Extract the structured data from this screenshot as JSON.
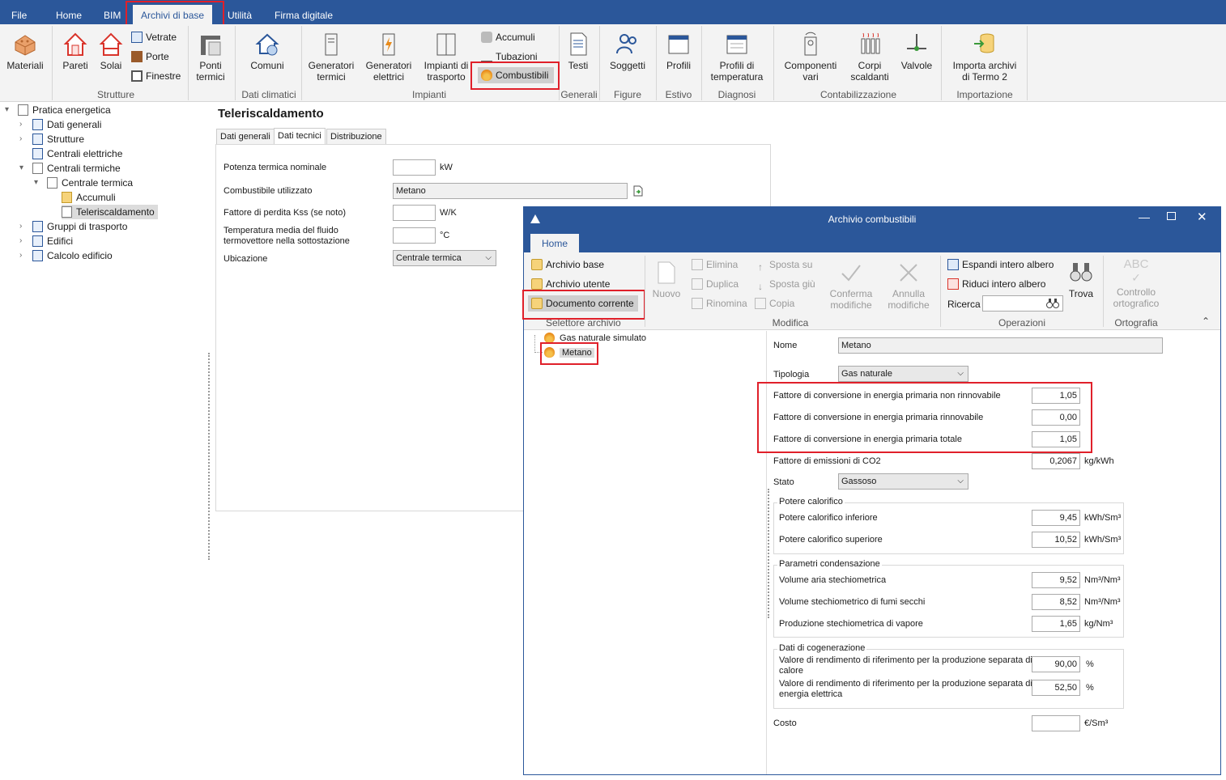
{
  "menubar": {
    "items": [
      "File",
      "Home",
      "BIM",
      "Archivi di base",
      "Utilità",
      "Firma digitale"
    ],
    "active": "Archivi di base"
  },
  "ribbon": {
    "materiali": "Materiali",
    "pareti": "Pareti",
    "solai": "Solai",
    "vetrate": "Vetrate",
    "porte": "Porte",
    "finestre": "Finestre",
    "ponti_termici_1": "Ponti",
    "ponti_termici_2": "termici",
    "comuni": "Comuni",
    "gen_termici_1": "Generatori",
    "gen_termici_2": "termici",
    "gen_elettrici_1": "Generatori",
    "gen_elettrici_2": "elettrici",
    "impianti_trasp_1": "Impianti di",
    "impianti_trasp_2": "trasporto",
    "accumuli": "Accumuli",
    "tubazioni": "Tubazioni",
    "combustibili": "Combustibili",
    "testi": "Testi",
    "soggetti": "Soggetti",
    "profili": "Profili",
    "profili_temp_1": "Profili di",
    "profili_temp_2": "temperatura",
    "componenti_1": "Componenti",
    "componenti_2": "vari",
    "corpi_1": "Corpi",
    "corpi_2": "scaldanti",
    "valvole": "Valvole",
    "importa_1": "Importa archivi",
    "importa_2": "di Termo 2",
    "groups": {
      "strutture": "Strutture",
      "dati_climatici": "Dati climatici",
      "impianti": "Impianti",
      "generali": "Generali",
      "figure": "Figure",
      "estivo": "Estivo",
      "diagnosi": "Diagnosi",
      "contabilizzazione": "Contabilizzazione",
      "importazione": "Importazione"
    }
  },
  "tree": {
    "root": "Pratica energetica",
    "dati_generali": "Dati generali",
    "strutture": "Strutture",
    "centrali_elettriche": "Centrali elettriche",
    "centrali_termiche": "Centrali termiche",
    "centrale_termica": "Centrale termica",
    "accumuli": "Accumuli",
    "teleriscaldamento": "Teleriscaldamento",
    "gruppi_trasporto": "Gruppi di trasporto",
    "edifici": "Edifici",
    "calcolo_edificio": "Calcolo edificio"
  },
  "panel": {
    "title": "Teleriscaldamento",
    "tabs": [
      "Dati generali",
      "Dati tecnici",
      "Distribuzione"
    ],
    "potenza_label": "Potenza termica nominale",
    "potenza_unit": "kW",
    "combustibile_label": "Combustibile utilizzato",
    "combustibile_value": "Metano",
    "kss_label": "Fattore di perdita Kss (se noto)",
    "kss_unit": "W/K",
    "temp_label_1": "Temperatura media del fluido",
    "temp_label_2": "termovettore nella sottostazione",
    "temp_unit": "°C",
    "ubicazione_label": "Ubicazione",
    "ubicazione_value": "Centrale termica"
  },
  "dialog": {
    "title": "Archivio combustibili",
    "tab_home": "Home",
    "archivio_base": "Archivio base",
    "archivio_utente": "Archivio utente",
    "documento_corrente": "Documento corrente",
    "selettore_archivio": "Selettore archivio",
    "nuovo": "Nuovo",
    "elimina": "Elimina",
    "duplica": "Duplica",
    "rinomina": "Rinomina",
    "sposta_su": "Sposta su",
    "sposta_giu": "Sposta giù",
    "copia": "Copia",
    "conferma_1": "Conferma",
    "conferma_2": "modifiche",
    "annulla_1": "Annulla",
    "annulla_2": "modifiche",
    "modifica_group": "Modifica",
    "espandi": "Espandi intero albero",
    "riduci": "Riduci intero albero",
    "ricerca": "Ricerca",
    "trova": "Trova",
    "operazioni_group": "Operazioni",
    "controllo_1": "Controllo",
    "controllo_2": "ortografico",
    "ortografia_group": "Ortografia",
    "abc": "ABC",
    "list": [
      "Gas naturale simulato",
      "Metano"
    ],
    "form": {
      "nome_label": "Nome",
      "nome_value": "Metano",
      "tipologia_label": "Tipologia",
      "tipologia_value": "Gas naturale",
      "fp_nren_label": "Fattore di conversione in energia primaria non rinnovabile",
      "fp_nren_value": "1,05",
      "fp_ren_label": "Fattore di conversione in energia primaria rinnovabile",
      "fp_ren_value": "0,00",
      "fp_tot_label": "Fattore di conversione in energia primaria totale",
      "fp_tot_value": "1,05",
      "co2_label": "Fattore di emissioni di CO2",
      "co2_value": "0,2067",
      "co2_unit": "kg/kWh",
      "stato_label": "Stato",
      "stato_value": "Gassoso",
      "potere_title": "Potere calorifico",
      "pci_label": "Potere calorifico inferiore",
      "pci_value": "9,45",
      "pci_unit": "kWh/Sm³",
      "pcs_label": "Potere calorifico superiore",
      "pcs_value": "10,52",
      "pcs_unit": "kWh/Sm³",
      "cond_title": "Parametri condensazione",
      "aria_label": "Volume aria stechiometrica",
      "aria_value": "9,52",
      "aria_unit": "Nm³/Nm³",
      "fumi_label": "Volume stechiometrico di fumi secchi",
      "fumi_value": "8,52",
      "fumi_unit": "Nm³/Nm³",
      "vapore_label": "Produzione stechiometrica di vapore",
      "vapore_value": "1,65",
      "vapore_unit": "kg/Nm³",
      "cogen_title": "Dati di cogenerazione",
      "rend_calore_1": "Valore di rendimento di riferimento per la produzione separata di",
      "rend_calore_2": "calore",
      "rend_calore_value": "90,00",
      "rend_calore_unit": "%",
      "rend_el_1": "Valore di rendimento di riferimento per la produzione separata di",
      "rend_el_2": "energia elettrica",
      "rend_el_value": "52,50",
      "rend_el_unit": "%",
      "costo_label": "Costo",
      "costo_unit": "€/Sm³"
    }
  },
  "colors": {
    "brand": "#2b579a",
    "highlight": "#e0202a",
    "flame": "#e88a1a"
  }
}
